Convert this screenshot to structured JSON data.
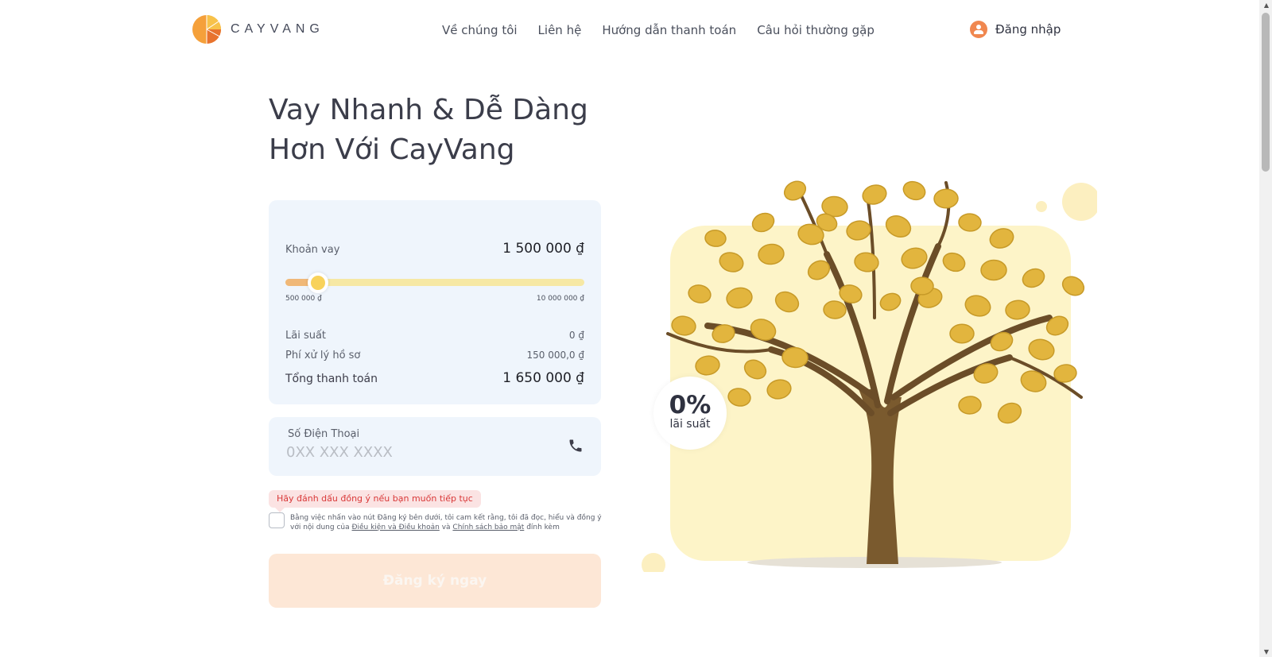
{
  "header": {
    "brand": "CAYVANG",
    "nav": [
      "Về chúng tôi",
      "Liên hệ",
      "Hướng dẫn thanh toán",
      "Câu hỏi thường gặp"
    ],
    "login_label": "Đăng nhập"
  },
  "hero": {
    "title_line1": "Vay Nhanh & Dễ Dàng",
    "title_line2": "Hơn Với CayVang"
  },
  "calculator": {
    "loan_label": "Khoản vay",
    "loan_value": "1 500 000 ₫",
    "slider_level_percent": 11,
    "min_label": "500 000 ₫",
    "max_label": "10 000 000 ₫",
    "interest_label": "Lãi suất",
    "interest_value": "0 ₫",
    "fee_label": "Phí xử lý hồ sơ",
    "fee_value": "150 000,0 ₫",
    "total_label": "Tổng thanh toán",
    "total_value": "1 650 000 ₫"
  },
  "phone": {
    "label": "Số Điện Thoại",
    "placeholder": "0XX XXX XXXX",
    "value": ""
  },
  "consent": {
    "warning": "Hãy đánh dấu đồng ý nếu bạn muốn tiếp tục",
    "text_part1": "Bằng việc nhấn vào nút Đăng ký bên dưới, tôi cam kết rằng, tôi đã đọc, hiểu và đồng ý với nội dung của",
    "terms_link": "Điều kiện và Điều khoản",
    "and": "và",
    "privacy_link": "Chính sách bảo mật",
    "text_part2": "đính kèm",
    "checked": false
  },
  "submit_label": "Đăng ký ngay",
  "badge": {
    "percent": "0%",
    "label": "lãi suất"
  },
  "colors": {
    "accent": "#f0874f",
    "slider_fill": "#f0b878",
    "slider_track": "#f6e8a4",
    "card_bg": "#eff5fc",
    "panel_bg": "#fdf4c8",
    "button_disabled": "#fde7d6",
    "warning": "#d93838"
  },
  "icons": [
    "logo-icon",
    "user-icon",
    "phone-icon",
    "money-tree-illustration"
  ]
}
